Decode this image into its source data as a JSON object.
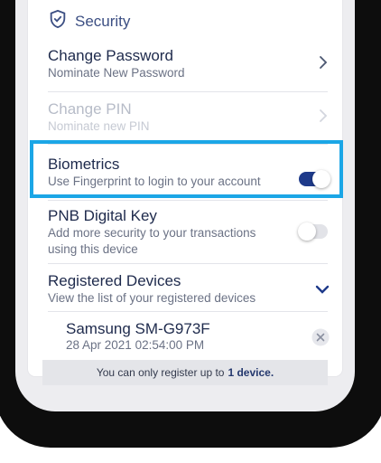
{
  "security": {
    "header": "Security",
    "items": [
      {
        "title": "Change Password",
        "subtitle": "Nominate New Password",
        "enabled": true
      },
      {
        "title": "Change PIN",
        "subtitle": "Nominate new PIN",
        "enabled": false
      },
      {
        "title": "Biometrics",
        "subtitle": "Use Fingerprint to login to your account",
        "toggle_on": true
      },
      {
        "title": "PNB Digital Key",
        "subtitle_line1": "Add more security to your transactions",
        "subtitle_line2": "using this device",
        "toggle_on": false
      },
      {
        "title": "Registered Devices",
        "subtitle": "View the list of your registered devices"
      }
    ],
    "device": {
      "name": "Samsung SM-G973F",
      "date": "28 Apr 2021 02:54:00 PM"
    },
    "note_prefix": "You can only register up to",
    "note_bold": "1 device."
  },
  "colors": {
    "accent": "#1e3a8a",
    "highlight": "#1ba6e6",
    "toggle_off": "#e2e3e8"
  },
  "icons": {
    "header": "shield-check-icon",
    "chevron_right": "chevron-right-icon",
    "chevron_down": "chevron-down-icon",
    "remove": "close-circle-icon"
  }
}
